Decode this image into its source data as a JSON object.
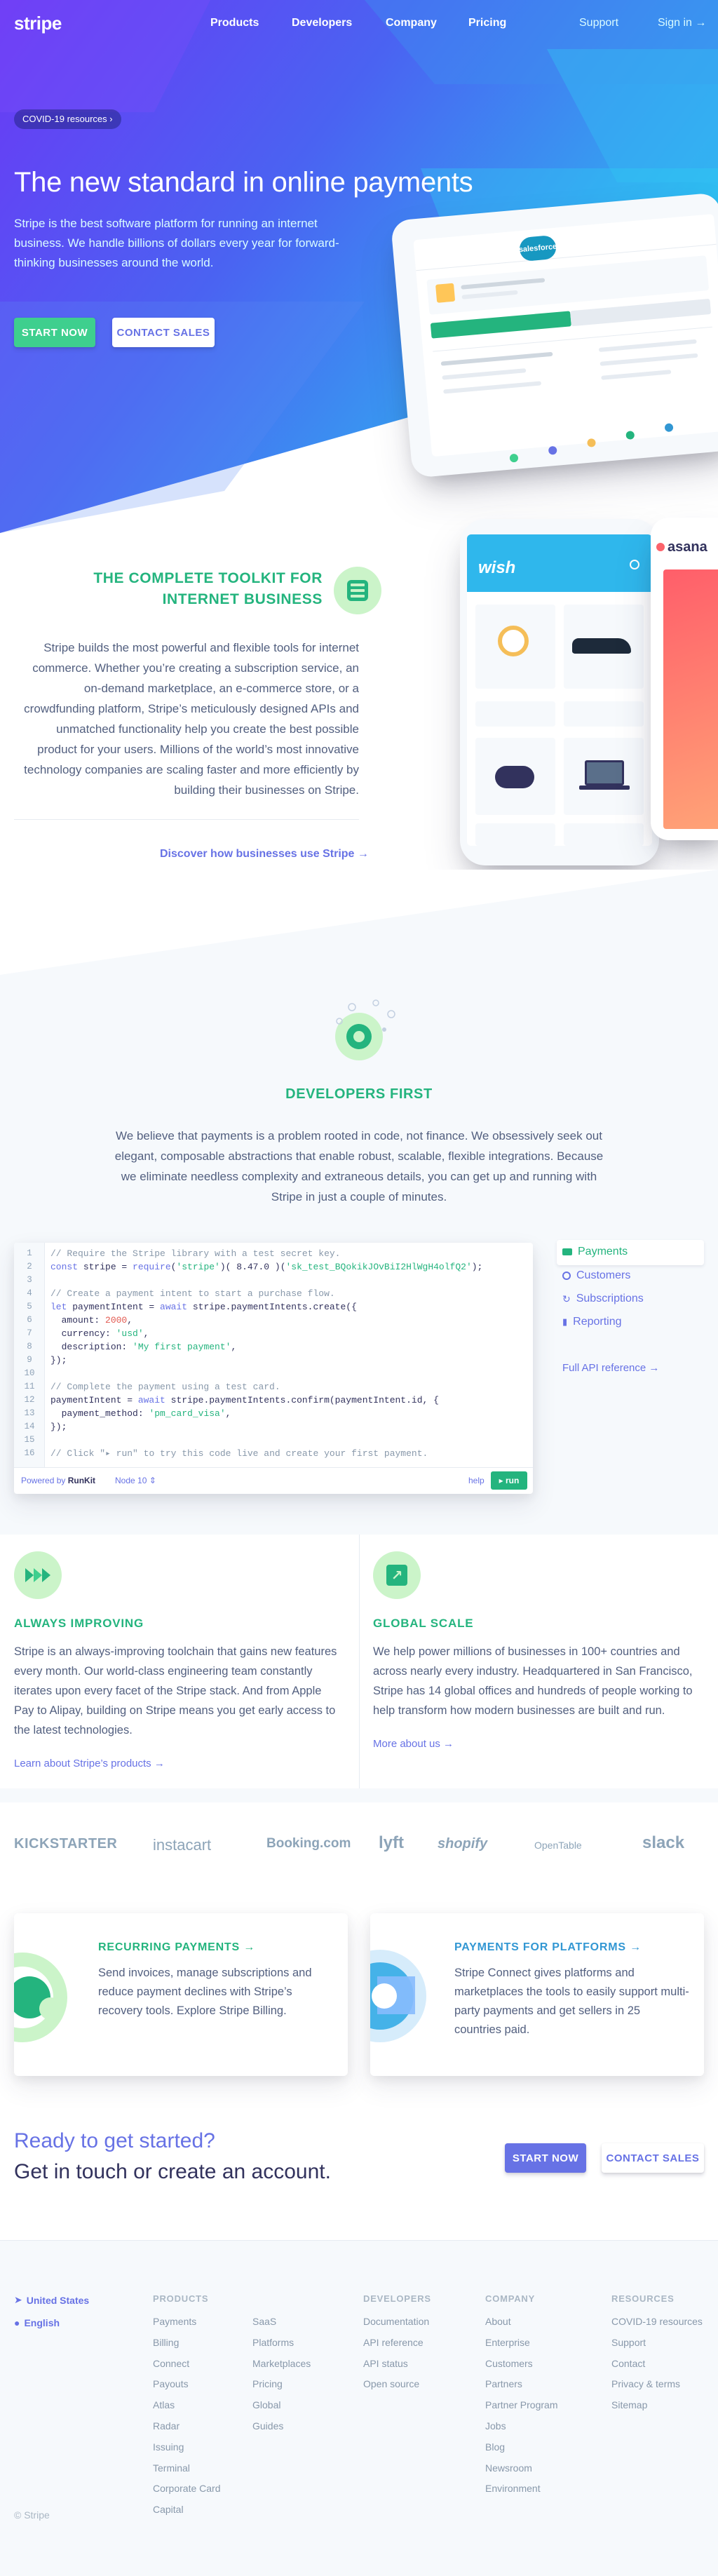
{
  "header": {
    "logo": "stripe",
    "nav": [
      "Products",
      "Developers",
      "Company",
      "Pricing"
    ],
    "support": "Support",
    "signin": "Sign in →"
  },
  "hero": {
    "covid_pill": "COVID-19 resources ›",
    "title": "The new standard in online payments",
    "subtitle": "Stripe is the best software platform for running an internet business. We handle billions of dollars every year for forward-thinking businesses around the world.",
    "start_now": "START NOW",
    "contact_sales": "CONTACT SALES"
  },
  "devices": {
    "tablet_brand": "salesforce",
    "phone_brand": "wish",
    "right_brand": "asana"
  },
  "toolkit": {
    "title": "THE COMPLETE TOOLKIT FOR INTERNET BUSINESS",
    "body": "Stripe builds the most powerful and flexible tools for internet commerce. Whether you’re creating a subscription service, an on-demand marketplace, an e-commerce store, or a crowdfunding platform, Stripe’s meticulously designed APIs and unmatched functionality help you create the best possible product for your users. Millions of the world’s most innovative technology companies are scaling faster and more efficiently by building their businesses on Stripe.",
    "link": "Discover how businesses use Stripe →"
  },
  "developers": {
    "title": "DEVELOPERS FIRST",
    "body": "We believe that payments is a problem rooted in code, not finance. We obsessively seek out elegant, composable abstractions that enable robust, scalable, flexible integrations. Because we eliminate needless complexity and extraneous details, you can get up and running with Stripe in just a couple of minutes."
  },
  "code": {
    "lines": [
      {
        "n": "1",
        "t": "// Require the Stripe library with a test secret key."
      },
      {
        "n": "2",
        "t": "const stripe = require('stripe')( 8.47.0 )('sk_test_BQokikJOvBiI2HlWgH4olfQ2');"
      },
      {
        "n": "3",
        "t": ""
      },
      {
        "n": "4",
        "t": "// Create a payment intent to start a purchase flow."
      },
      {
        "n": "5",
        "t": "let paymentIntent = await stripe.paymentIntents.create({"
      },
      {
        "n": "6",
        "t": "  amount: 2000,"
      },
      {
        "n": "7",
        "t": "  currency: 'usd',"
      },
      {
        "n": "8",
        "t": "  description: 'My first payment',"
      },
      {
        "n": "9",
        "t": "});"
      },
      {
        "n": "10",
        "t": ""
      },
      {
        "n": "11",
        "t": "// Complete the payment using a test card."
      },
      {
        "n": "12",
        "t": "paymentIntent = await stripe.paymentIntents.confirm(paymentIntent.id, {"
      },
      {
        "n": "13",
        "t": "  payment_method: 'pm_card_visa',"
      },
      {
        "n": "14",
        "t": "});"
      },
      {
        "n": "15",
        "t": ""
      },
      {
        "n": "16",
        "t": "// Click \"▸ run\" to try this code live and create your first payment."
      }
    ],
    "powered_by": "Powered by",
    "runkit": "RunKit",
    "node": "Node 10 ⇕",
    "help": "help",
    "run": "▸ run"
  },
  "api_menu": {
    "items": [
      "Payments",
      "Customers",
      "Subscriptions",
      "Reporting"
    ],
    "reference": "Full API reference →"
  },
  "features": {
    "left": {
      "title": "ALWAYS IMPROVING",
      "body": "Stripe is an always-improving toolchain that gains new features every month. Our world-class engineering team constantly iterates upon every facet of the Stripe stack. And from Apple Pay to Alipay, building on Stripe means you get early access to the latest technologies.",
      "link": "Learn about Stripe’s products →"
    },
    "right": {
      "title": "GLOBAL SCALE",
      "body": "We help power millions of businesses in 100+ countries and across nearly every industry. Headquartered in San Francisco, Stripe has 14 global offices and hundreds of people working to help transform how modern businesses are built and run.",
      "link": "More about us →"
    }
  },
  "logos": [
    "KICKSTARTER",
    "instacart",
    "Booking.com",
    "lyft",
    "shopify",
    "OpenTable",
    "slack"
  ],
  "cards": {
    "recurring": {
      "title": "RECURRING PAYMENTS →",
      "body": "Send invoices, manage subscriptions and reduce payment declines with Stripe’s recovery tools. Explore Stripe Billing."
    },
    "platforms": {
      "title": "PAYMENTS FOR PLATFORMS →",
      "body": "Stripe Connect gives platforms and marketplaces the tools to easily support multi-party payments and get sellers in 25 countries paid."
    }
  },
  "cta": {
    "line1": "Ready to get started?",
    "line2": "Get in touch or create an account.",
    "start_now": "START NOW",
    "contact_sales": "CONTACT SALES"
  },
  "footer": {
    "country": "United States",
    "language": "English",
    "copyright": "© Stripe",
    "products_heading": "PRODUCTS",
    "products_col1": [
      "Payments",
      "Billing",
      "Connect",
      "Payouts",
      "Atlas",
      "Radar",
      "Issuing",
      "Terminal",
      "Corporate Card",
      "Capital"
    ],
    "products_col2": [
      "SaaS",
      "Platforms",
      "Marketplaces",
      "Pricing",
      "Global",
      "Guides"
    ],
    "developers_heading": "DEVELOPERS",
    "developers": [
      "Documentation",
      "API reference",
      "API status",
      "Open source"
    ],
    "company_heading": "COMPANY",
    "company": [
      "About",
      "Enterprise",
      "Customers",
      "Partners",
      "Partner Program",
      "Jobs",
      "Blog",
      "Newsroom",
      "Environment"
    ],
    "resources_heading": "RESOURCES",
    "resources": [
      "COVID-19 resources",
      "Support",
      "Contact",
      "Privacy & terms",
      "Sitemap"
    ]
  },
  "colors": {
    "accent_green": "#24b47e",
    "brand_purple": "#6772e5",
    "hero_gradient_start": "#6b38f5",
    "hero_gradient_end": "#2bc0f0",
    "heading_dark": "#32325d"
  }
}
